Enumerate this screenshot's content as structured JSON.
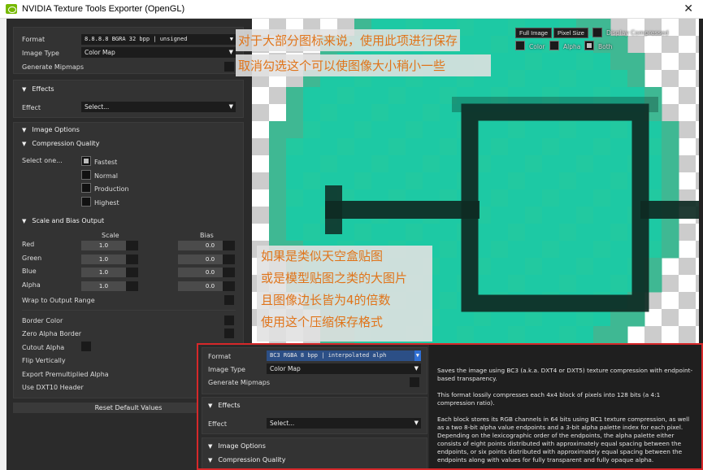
{
  "window": {
    "title": "NVIDIA Texture Tools Exporter (OpenGL)",
    "close_glyph": "✕"
  },
  "main": {
    "format_label": "Format",
    "format_value": "8.8.8.8   BGRA   32 bpp | unsigned",
    "image_type_label": "Image Type",
    "image_type_value": "Color Map",
    "mipmaps_label": "Generate Mipmaps",
    "effects_header": "Effects",
    "effect_label": "Effect",
    "effect_value": "Select...",
    "image_options_header": "Image Options",
    "compression_header": "Compression Quality",
    "select_one": "Select one...",
    "quality_options": [
      "Fastest",
      "Normal",
      "Production",
      "Highest"
    ],
    "quality_selected": "Fastest",
    "scale_bias_header": "Scale and Bias Output",
    "scale_col": "Scale",
    "bias_col": "Bias",
    "channels": [
      {
        "label": "Red",
        "scale": "1.0",
        "bias": "0.0"
      },
      {
        "label": "Green",
        "scale": "1.0",
        "bias": "0.0"
      },
      {
        "label": "Blue",
        "scale": "1.0",
        "bias": "0.0"
      },
      {
        "label": "Alpha",
        "scale": "1.0",
        "bias": "0.0"
      }
    ],
    "wrap_label": "Wrap to Output Range",
    "border_color_label": "Border Color",
    "zero_alpha_label": "Zero Alpha Border",
    "cutout_alpha_label": "Cutout Alpha",
    "flip_vertically_label": "Flip Vertically",
    "export_premult_label": "Export Premultiplied Alpha",
    "dxt10_label": "Use DXT10 Header",
    "reset_button": "Reset Default Values"
  },
  "viewer": {
    "full_image": "Full Image",
    "pixel_size": "Pixel Size",
    "display_compressed": "Display Compressed",
    "color": "Color",
    "alpha": "Alpha",
    "both": "Both"
  },
  "annotations": {
    "top_lines": [
      "对于大部分图标来说，使用此项进行保存",
      "取消勾选这个可以使图像大小稍小一些"
    ],
    "middle_lines": [
      "如果是类似天空盒贴图",
      "或是模型贴图之类的大图片",
      "且图像边长皆为4的倍数",
      "使用这个压缩保存格式"
    ]
  },
  "popup": {
    "format_label": "Format",
    "format_value": "BC3        RGBA    8 bpp | interpolated alph",
    "image_type_label": "Image Type",
    "image_type_value": "Color Map",
    "mipmaps_label": "Generate Mipmaps",
    "effects_header": "Effects",
    "effect_label": "Effect",
    "effect_value": "Select...",
    "image_options_header": "Image Options",
    "compression_header": "Compression Quality",
    "tooltip": [
      "Saves the image using BC3 (a.k.a. DXT4 or DXT5) texture compression with endpoint-based transparency.",
      "This format lossily compresses each 4x4 block of pixels into 128 bits (a 4:1 compression ratio).",
      "Each block stores its RGB channels in 64 bits using BC1 texture compression, as well as a two 8-bit alpha value endpoints and a 3-bit alpha palette index for each pixel. Depending on the lexicographic order of the endpoints, the alpha palette either consists of eight points distributed with approximately equal spacing between the endpoints, or six points distributed with approximately equal spacing between the endpoints along with values for fully transparent and fully opaque alpha."
    ]
  },
  "colors": {
    "teal": "#1dc9a4",
    "icon_dark": "#0e2a23",
    "accent_red": "#d6282a",
    "annotation_text": "#e0741a",
    "dropdown_blue": "#2f6fd4"
  }
}
